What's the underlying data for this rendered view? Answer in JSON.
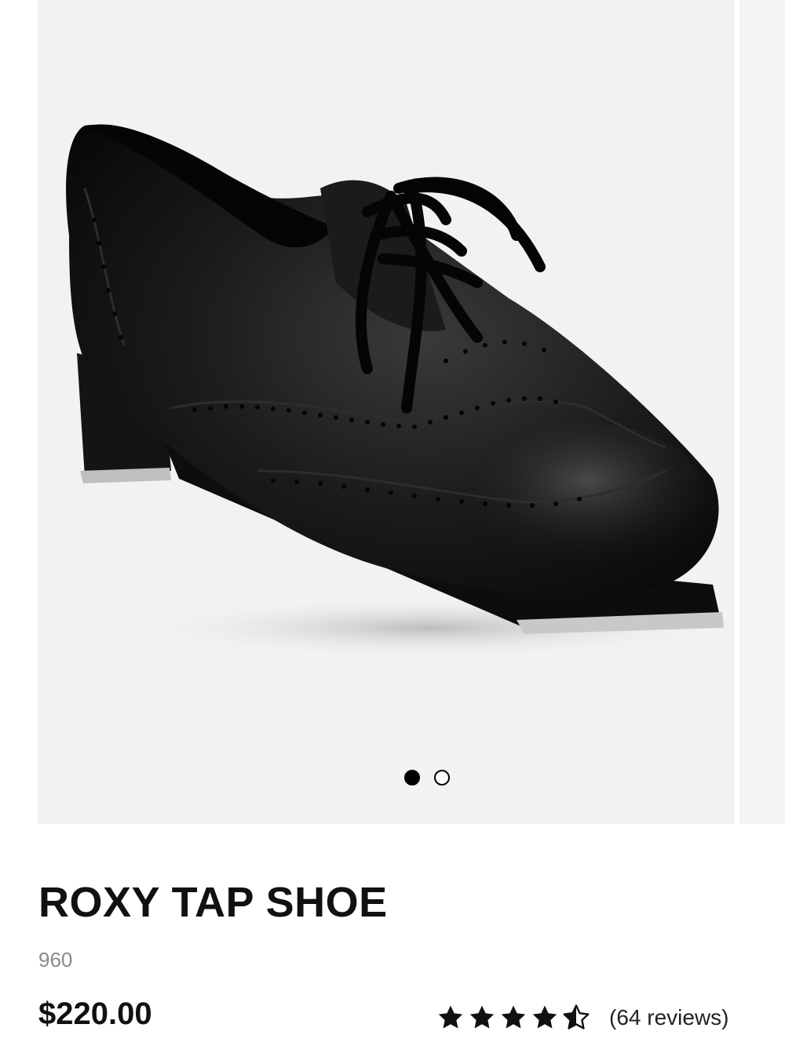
{
  "product": {
    "title": "ROXY TAP SHOE",
    "sku": "960",
    "price": "$220.00",
    "rating": 4.5,
    "rating_max": 5,
    "reviews_label": "(64 reviews)"
  },
  "gallery": {
    "slide_count": 2,
    "active_slide": 1,
    "image_subject": "black-wingtip-tap-shoe"
  },
  "colors": {
    "text": "#111111",
    "muted": "#8a8a8a",
    "image_bg": "#f2f2f2"
  }
}
